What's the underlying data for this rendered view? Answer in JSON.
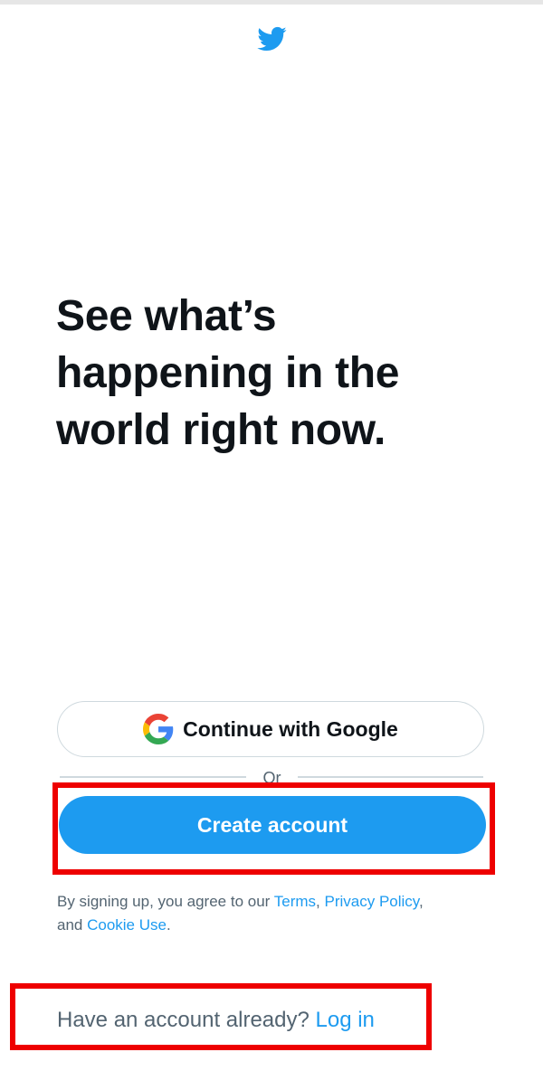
{
  "app": {
    "logo_icon": "twitter-bird-icon",
    "brand_color": "#1d9bf0"
  },
  "headline": {
    "line1": "See what’s",
    "line2": "happening in the",
    "line3": "world right now."
  },
  "google_button": {
    "icon": "google-g-icon",
    "label": "Continue with Google"
  },
  "divider": {
    "label": "Or"
  },
  "create_account": {
    "label": "Create account"
  },
  "legal": {
    "prefix": "By signing up, you agree to our ",
    "terms": "Terms",
    "sep1": ", ",
    "privacy": "Privacy Policy",
    "sep2": ",",
    "middle": " and ",
    "cookie": "Cookie Use",
    "suffix": "."
  },
  "login": {
    "prompt": "Have an account already? ",
    "link": "Log in"
  },
  "annotations": {
    "highlight_color": "#ee0000"
  }
}
